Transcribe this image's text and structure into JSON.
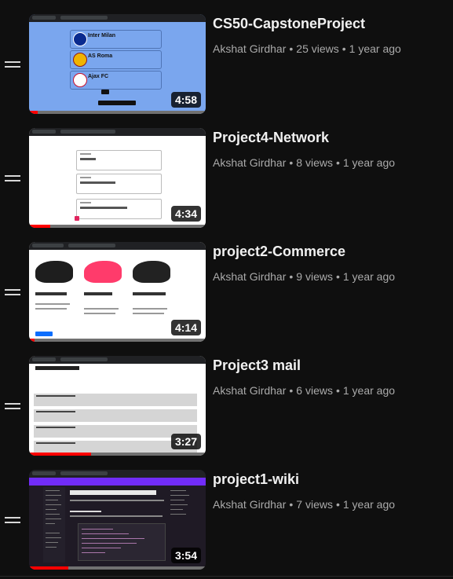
{
  "playlist": {
    "items": [
      {
        "title": "CS50-CapstoneProject",
        "channel": "Akshat Girdhar",
        "views": "25 views",
        "age": "1 year ago",
        "duration": "4:58",
        "watched": 0.05,
        "thumb_text": {
          "team1": "Inter Milan",
          "team2": "AS Roma",
          "team3": "Ajax FC"
        }
      },
      {
        "title": "Project4-Network",
        "channel": "Akshat Girdhar",
        "views": "8 views",
        "age": "1 year ago",
        "duration": "4:34",
        "watched": 0.12
      },
      {
        "title": "project2-Commerce",
        "channel": "Akshat Girdhar",
        "views": "9 views",
        "age": "1 year ago",
        "duration": "4:14",
        "watched": 0.03,
        "thumb_text": {
          "item1": "X CRAZYFAST.4 FLEX GROUND",
          "item2": "NikeCourt Air Zoom Vapor 9.5Tour",
          "item3": "NikeCourt Zoom Vapor Cage 4 Rafa"
        }
      },
      {
        "title": "Project3 mail",
        "channel": "Akshat Girdhar",
        "views": "6 views",
        "age": "1 year ago",
        "duration": "3:27",
        "watched": 0.35,
        "thumb_text": {
          "account": "ron@hogwarts.com",
          "inbox": "Inbox"
        }
      },
      {
        "title": "project1-wiki",
        "channel": "Akshat Girdhar",
        "views": "7 views",
        "age": "1 year ago",
        "duration": "3:54",
        "watched": 0.22,
        "thumb_text": {
          "heading": "Get started with Bootstrap",
          "section": "Quick start"
        }
      }
    ]
  },
  "colors": {
    "progress": "#ff0000",
    "background": "#0f0f0f",
    "meta": "#aaaaaa"
  },
  "icons": {
    "handle": "drag-handle-icon"
  }
}
